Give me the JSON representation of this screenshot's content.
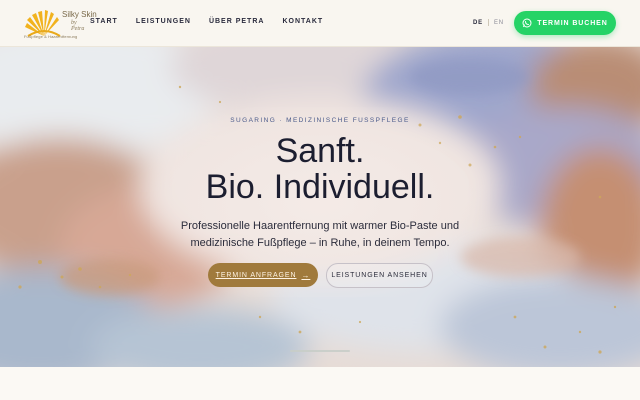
{
  "logo": {
    "brand": "Silky Skin",
    "script": "by Petra",
    "tagline": "Fußpflege & Haarentfernung"
  },
  "nav": {
    "items": [
      {
        "label": "START"
      },
      {
        "label": "LEISTUNGEN"
      },
      {
        "label": "ÜBER PETRA"
      },
      {
        "label": "KONTAKT"
      }
    ]
  },
  "lang": {
    "active": "DE",
    "inactive": "EN"
  },
  "header_button": {
    "label": "TERMIN BUCHEN",
    "icon": "whatsapp-icon",
    "color": "#25d366"
  },
  "hero": {
    "eyebrow": "SUGARING · MEDIZINISCHE FUSSPFLEGE",
    "headline_line1": "Sanft.",
    "headline_line2": "Bio. Individuell.",
    "sub_line1": "Professionelle Haarentfernung mit warmer Bio-Paste und",
    "sub_line2": "medizinische Fußpflege – in Ruhe, in deinem Tempo.",
    "cta_primary": {
      "label": "TERMIN ANFRAGEN",
      "icon": "arrow-right-icon",
      "color": "#a07a3c"
    },
    "cta_secondary": {
      "label": "LEISTUNGEN ANSEHEN"
    }
  },
  "colors": {
    "accent_gold": "#a07a3c",
    "whatsapp_green": "#25d366",
    "text_dark": "#1c1e30"
  }
}
